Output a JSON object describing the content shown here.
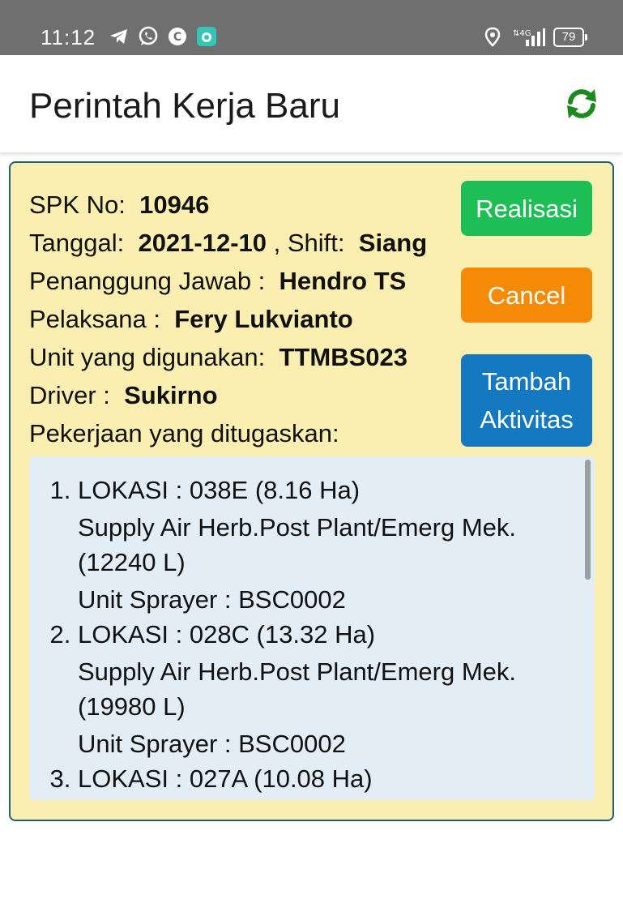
{
  "status_bar": {
    "time": "11:12",
    "left_icons": [
      "telegram-icon",
      "whatsapp-icon",
      "c-app-icon",
      "camera-app-icon"
    ],
    "right_icons": [
      "location-icon",
      "signal-4g-icon"
    ],
    "battery": "79"
  },
  "app_bar": {
    "title": "Perintah Kerja Baru",
    "refresh_icon": "refresh-icon",
    "refresh_color": "#1e8a1e"
  },
  "card": {
    "spk_label": "SPK No:",
    "spk_value": "10946",
    "tanggal_label": "Tanggal:",
    "tanggal_value": "2021-12-10",
    "shift_label": ", Shift:",
    "shift_value": "Siang",
    "penanggung_label": "Penanggung Jawab :",
    "penanggung_value": "Hendro TS",
    "pelaksana_label": "Pelaksana :",
    "pelaksana_value": "Fery Lukvianto",
    "unit_label": "Unit yang digunakan:",
    "unit_value": "TTMBS023",
    "driver_label": "Driver :",
    "driver_value": "Sukirno",
    "pekerjaan_label": "Pekerjaan yang ditugaskan:",
    "background": "#fbeeb1"
  },
  "buttons": {
    "realisasi": "Realisasi",
    "cancel": "Cancel",
    "tambah_line1": "Tambah",
    "tambah_line2": "Aktivitas",
    "colors": {
      "realisasi": "#1dbe56",
      "cancel": "#f58a07",
      "tambah": "#1479c0"
    }
  },
  "tasks": [
    {
      "lokasi": "LOKASI : 038E (8.16 Ha)",
      "pekerjaan": "Supply Air Herb.Post Plant/Emerg Mek. (12240 L)",
      "unit": "Unit Sprayer : BSC0002"
    },
    {
      "lokasi": "LOKASI : 028C (13.32 Ha)",
      "pekerjaan": "Supply Air Herb.Post Plant/Emerg Mek. (19980 L)",
      "unit": "Unit Sprayer : BSC0002"
    },
    {
      "lokasi": "LOKASI : 027A (10.08 Ha)",
      "pekerjaan": "",
      "unit": ""
    }
  ]
}
